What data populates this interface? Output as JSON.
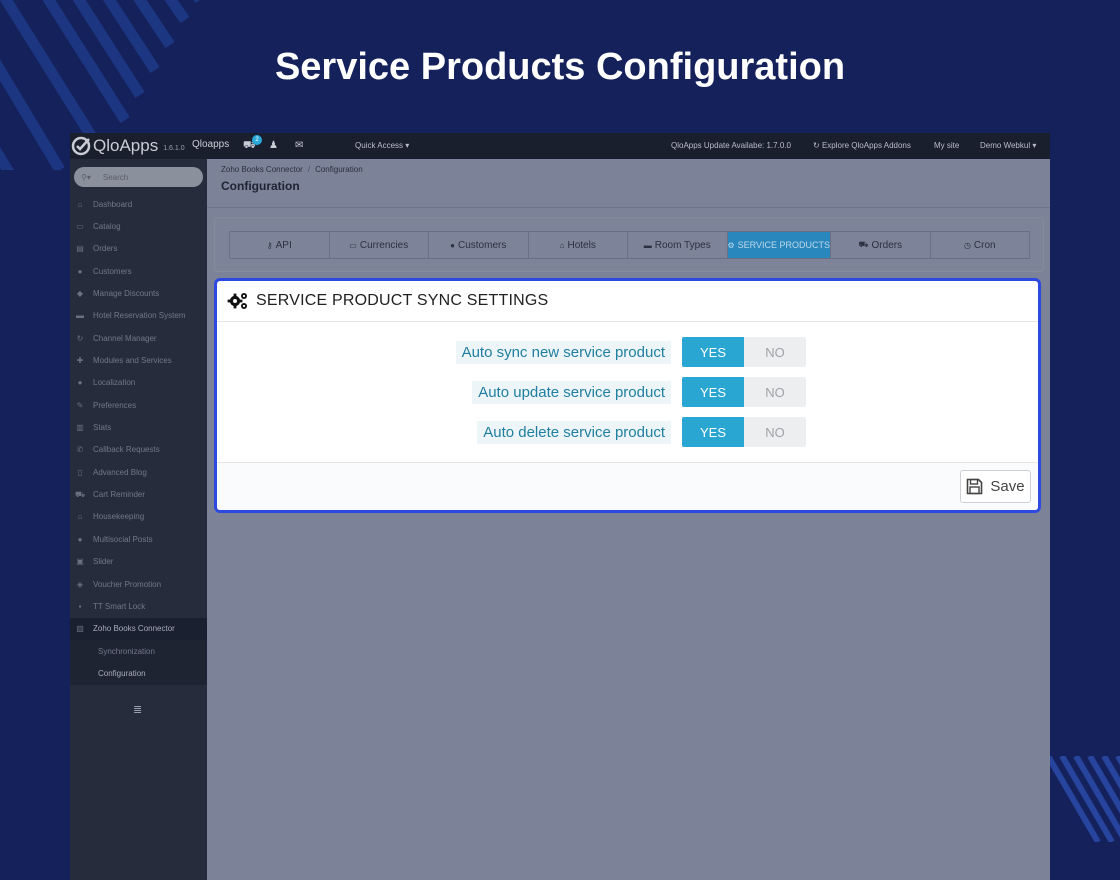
{
  "hero_title": "Service Products Configuration",
  "topbar": {
    "brand": "QloApps",
    "version": "1.6.1.0",
    "shop_name": "Qloapps",
    "cart_badge": "2",
    "quick_access": "Quick Access",
    "update_notice": "QloApps Update Availabe: 1.7.0.0",
    "explore_addons": "Explore QloApps Addons",
    "my_site": "My site",
    "user": "Demo Webkul"
  },
  "sidebar": {
    "search_placeholder": "Search",
    "items": [
      {
        "label": "Dashboard",
        "icon": "dashboard-icon",
        "glyph": "⌂"
      },
      {
        "label": "Catalog",
        "icon": "catalog-icon",
        "glyph": "▭"
      },
      {
        "label": "Orders",
        "icon": "orders-icon",
        "glyph": "▤"
      },
      {
        "label": "Customers",
        "icon": "customers-icon",
        "glyph": "●"
      },
      {
        "label": "Manage Discounts",
        "icon": "tag-icon",
        "glyph": "◆"
      },
      {
        "label": "Hotel Reservation System",
        "icon": "bed-icon",
        "glyph": "▬"
      },
      {
        "label": "Channel Manager",
        "icon": "sync-icon",
        "glyph": "↻"
      },
      {
        "label": "Modules and Services",
        "icon": "puzzle-icon",
        "glyph": "✚"
      },
      {
        "label": "Localization",
        "icon": "globe-icon",
        "glyph": "●"
      },
      {
        "label": "Preferences",
        "icon": "wrench-icon",
        "glyph": "✎"
      },
      {
        "label": "Stats",
        "icon": "bar-chart-icon",
        "glyph": "▥"
      },
      {
        "label": "Callback Requests",
        "icon": "phone-icon",
        "glyph": "✆"
      },
      {
        "label": "Advanced Blog",
        "icon": "bookmark-icon",
        "glyph": "▯"
      },
      {
        "label": "Cart Reminder",
        "icon": "cart-icon",
        "glyph": "⛟"
      },
      {
        "label": "Housekeeping",
        "icon": "home-icon",
        "glyph": "⌂"
      },
      {
        "label": "Multisocial Posts",
        "icon": "globe-icon",
        "glyph": "●"
      },
      {
        "label": "Slider",
        "icon": "slider-icon",
        "glyph": "▣"
      },
      {
        "label": "Voucher Promotion",
        "icon": "voucher-icon",
        "glyph": "◈"
      },
      {
        "label": "TT Smart Lock",
        "icon": "lock-icon",
        "glyph": "▪"
      },
      {
        "label": "Zoho Books Connector",
        "icon": "zoho-icon",
        "glyph": "▧"
      }
    ],
    "sub_items": [
      "Synchronization",
      "Configuration"
    ]
  },
  "breadcrumb": {
    "parent": "Zoho Books Connector",
    "current": "Configuration"
  },
  "page_title": "Configuration",
  "tabs": [
    {
      "label": "API",
      "icon": "key-icon",
      "glyph": "⚷",
      "active": false
    },
    {
      "label": "Currencies",
      "icon": "money-icon",
      "glyph": "▭",
      "active": false
    },
    {
      "label": "Customers",
      "icon": "user-icon",
      "glyph": "●",
      "active": false
    },
    {
      "label": "Hotels",
      "icon": "home-icon",
      "glyph": "⌂",
      "active": false
    },
    {
      "label": "Room Types",
      "icon": "bed-icon",
      "glyph": "▬",
      "active": false
    },
    {
      "label": "SERVICE PRODUCTS",
      "icon": "cogs-icon",
      "glyph": "⚙",
      "active": true
    },
    {
      "label": "Orders",
      "icon": "cart-icon",
      "glyph": "⛟",
      "active": false
    },
    {
      "label": "Cron",
      "icon": "clock-icon",
      "glyph": "◷",
      "active": false
    }
  ],
  "panel": {
    "title": "SERVICE PRODUCT SYNC SETTINGS",
    "settings": [
      {
        "label": "Auto sync new service product",
        "yes": "YES",
        "no": "NO",
        "value": "YES"
      },
      {
        "label": "Auto update service product",
        "yes": "YES",
        "no": "NO",
        "value": "YES"
      },
      {
        "label": "Auto delete service product",
        "yes": "YES",
        "no": "NO",
        "value": "YES"
      }
    ],
    "save_label": "Save"
  },
  "colors": {
    "background": "#14215a",
    "panel_border": "#2d4ae0",
    "switch_active": "#2aa6d2",
    "tab_active": "#2a87be"
  }
}
